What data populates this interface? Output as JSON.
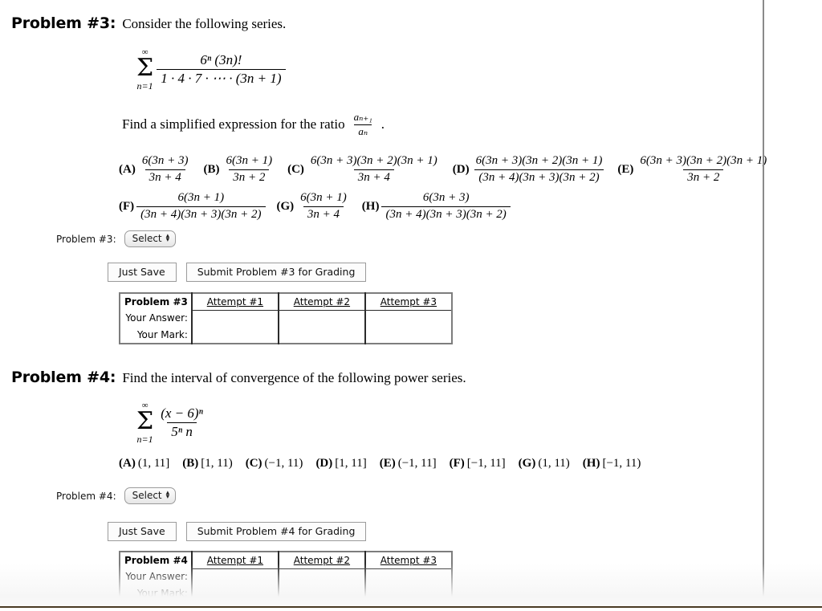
{
  "page": {
    "background_color": "#ffffff",
    "divider_color": "#8a8a8a",
    "bottom_edge_color": "#4a3a24"
  },
  "problems": [
    {
      "id": "problem-3",
      "label": "Problem #3:",
      "statement": "Consider the following series.",
      "series": {
        "sum_upper": "∞",
        "sum_lower": "n=1",
        "numerator": "6ⁿ (3n)!",
        "denominator": "1 · 4 · 7 · ⋯ · (3n + 1)"
      },
      "question": {
        "text_before": "Find a simplified expression for the ratio",
        "ratio_numerator": "aₙ₊₁",
        "ratio_denominator": "aₙ",
        "text_after": "."
      },
      "choices": [
        {
          "tag": "(A)",
          "numerator": "6(3n + 3)",
          "denominator": "3n + 4"
        },
        {
          "tag": "(B)",
          "numerator": "6(3n + 1)",
          "denominator": "3n + 2"
        },
        {
          "tag": "(C)",
          "numerator": "6(3n + 3)(3n + 2)(3n + 1)",
          "denominator": "3n + 4"
        },
        {
          "tag": "(D)",
          "numerator": "6(3n + 3)(3n + 2)(3n + 1)",
          "denominator": "(3n + 4)(3n + 3)(3n + 2)"
        },
        {
          "tag": "(E)",
          "numerator": "6(3n + 3)(3n + 2)(3n + 1)",
          "denominator": "3n + 2"
        },
        {
          "tag": "(F)",
          "numerator": "6(3n + 1)",
          "denominator": "(3n + 4)(3n + 3)(3n + 2)"
        },
        {
          "tag": "(G)",
          "numerator": "6(3n + 1)",
          "denominator": "3n + 4"
        },
        {
          "tag": "(H)",
          "numerator": "6(3n + 3)",
          "denominator": "(3n + 4)(3n + 3)(3n + 2)"
        }
      ],
      "form": {
        "select_label": "Problem #3:",
        "select_value": "Select",
        "just_save_label": "Just Save",
        "submit_label": "Submit Problem #3 for Grading"
      },
      "table": {
        "corner_label": "Problem #3",
        "column_headers": [
          "Attempt #1",
          "Attempt #2",
          "Attempt #3"
        ],
        "row_headers": [
          "Your Answer:",
          "Your Mark:"
        ],
        "rows": [
          [
            "",
            "",
            ""
          ],
          [
            "",
            "",
            ""
          ]
        ]
      }
    },
    {
      "id": "problem-4",
      "label": "Problem #4:",
      "statement": "Find the interval of convergence of the following power series.",
      "series": {
        "sum_upper": "∞",
        "sum_lower": "n=1",
        "numerator": "(x − 6)ⁿ",
        "denominator": "5ⁿ n"
      },
      "choices": [
        {
          "tag": "(A)",
          "value": "(1, 11]"
        },
        {
          "tag": "(B)",
          "value": "[1, 11)"
        },
        {
          "tag": "(C)",
          "value": "(−1, 11)"
        },
        {
          "tag": "(D)",
          "value": "[1, 11]"
        },
        {
          "tag": "(E)",
          "value": "(−1, 11]"
        },
        {
          "tag": "(F)",
          "value": "[−1, 11]"
        },
        {
          "tag": "(G)",
          "value": "(1, 11)"
        },
        {
          "tag": "(H)",
          "value": "[−1, 11)"
        }
      ],
      "form": {
        "select_label": "Problem #4:",
        "select_value": "Select",
        "just_save_label": "Just Save",
        "submit_label": "Submit Problem #4 for Grading"
      },
      "table": {
        "corner_label": "Problem #4",
        "column_headers": [
          "Attempt #1",
          "Attempt #2",
          "Attempt #3"
        ],
        "row_headers": [
          "Your Answer:",
          "Your Mark:"
        ],
        "rows": [
          [
            "",
            "",
            ""
          ],
          [
            "",
            "",
            ""
          ]
        ]
      }
    }
  ],
  "icons": {
    "spinner_up": "▴",
    "spinner_down": "▾"
  }
}
